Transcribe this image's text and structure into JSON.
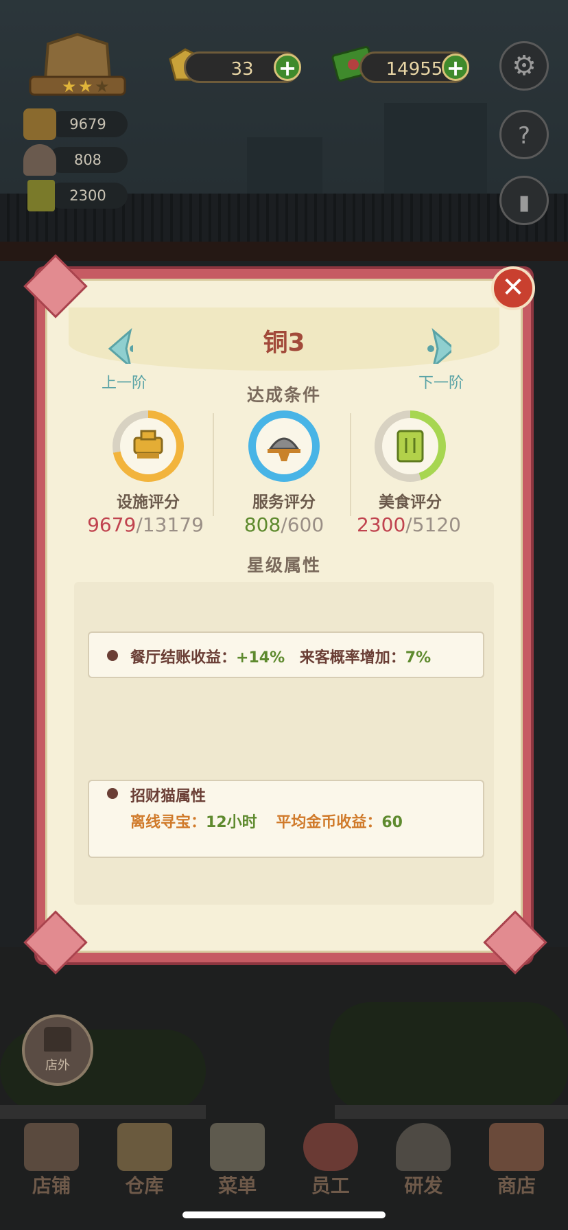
{
  "hud": {
    "gems": "33",
    "cash": "14955",
    "stats": [
      "9679",
      "808",
      "2300"
    ]
  },
  "modal": {
    "title": "铜3",
    "prev_label": "上一阶",
    "next_label": "下一阶",
    "conditions_title": "达成条件",
    "scores": [
      {
        "label": "设施评分",
        "current": "9679",
        "target": "/13179",
        "ring_color": "#f2b43c",
        "current_color": "#c0434f",
        "icon": "pot-icon"
      },
      {
        "label": "服务评分",
        "current": "808",
        "target": "/600",
        "ring_color": "#48b4e6",
        "current_color": "#5e8a2e",
        "icon": "cloche-icon"
      },
      {
        "label": "美食评分",
        "current": "2300",
        "target": "/5120",
        "ring_color": "#a7d651",
        "current_color": "#c0434f",
        "icon": "recipe-book-icon"
      }
    ],
    "star_title": "星级属性",
    "prop1": {
      "label1": "餐厅结账收益：",
      "val1": "+14%",
      "label2": "来客概率增加：",
      "val2": "7%"
    },
    "prop2": {
      "heading": "招财猫属性",
      "label1": "离线寻宝：",
      "val1": "12小时",
      "label2": "平均金币收益：",
      "val2": "60"
    }
  },
  "left_button": "店外",
  "bottom_nav": [
    "店铺",
    "仓库",
    "菜单",
    "员工",
    "研发",
    "商店"
  ],
  "colors": {
    "accent": "#c65b63",
    "paper": "#f6f0d8"
  }
}
